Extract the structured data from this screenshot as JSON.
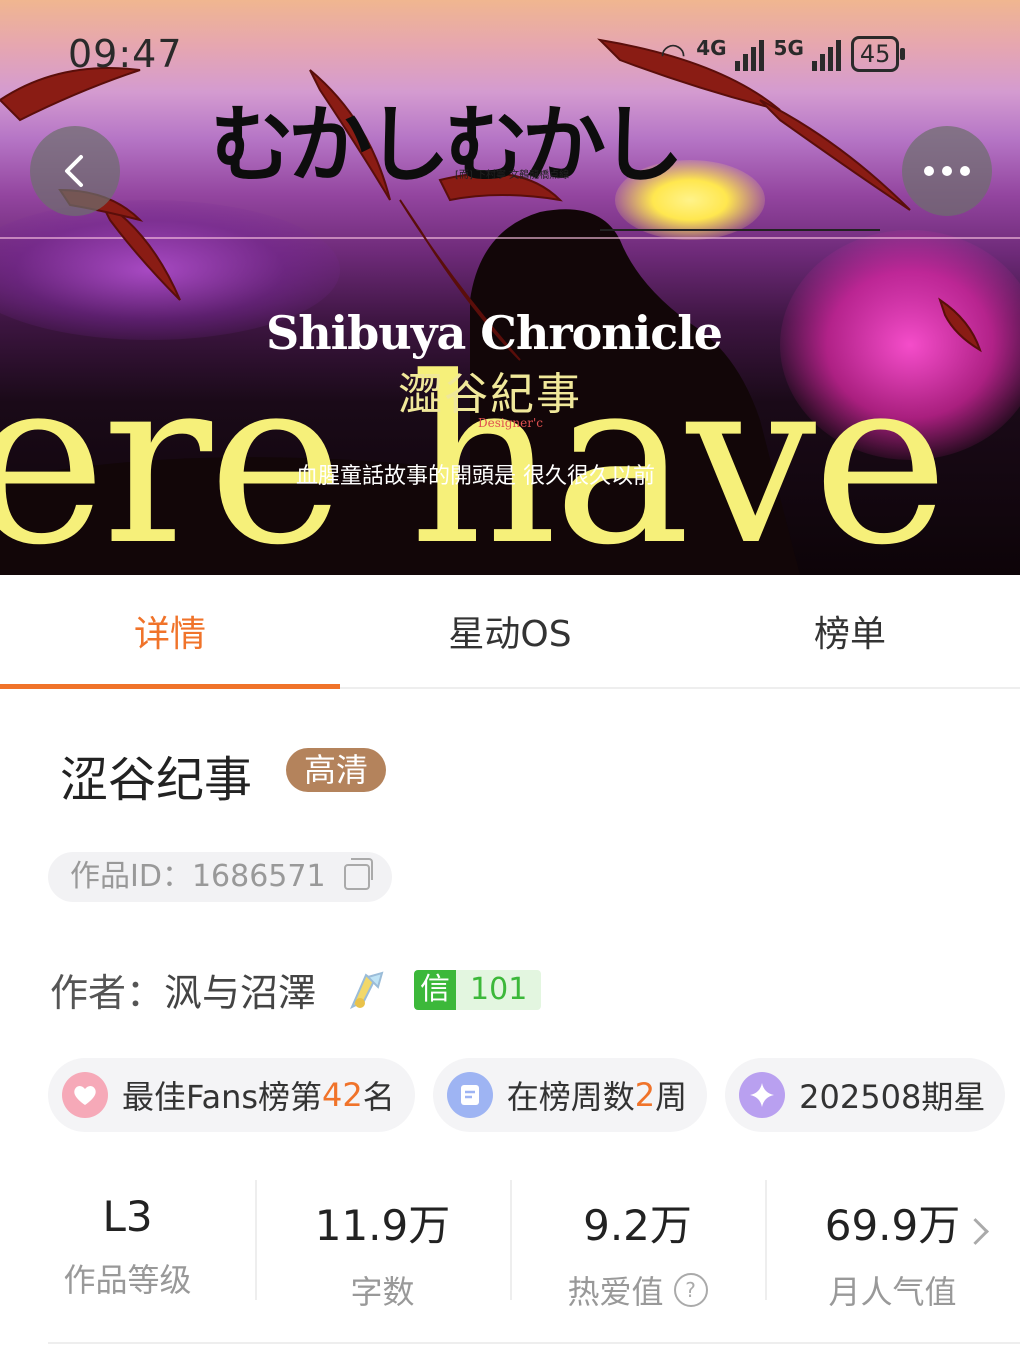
{
  "status_bar": {
    "time": "09:47",
    "net1": "4G",
    "net2": "5G",
    "battery": "45"
  },
  "banner": {
    "jp_title": "むかしむかし",
    "jp_sub": "[而] 下村寧  文鶴龍橋点線",
    "en_title": "Shibuya Chronicle",
    "cn_title": "澀谷紀事",
    "designer": "Designer'c",
    "tagline": "血腥童話故事的開頭是 很久很久以前",
    "big_text": "ere have a thou"
  },
  "nav": {
    "back_icon": "chevron-left-icon",
    "more_icon": "more-horizontal-icon"
  },
  "tabs": [
    {
      "label": "详情",
      "active": true
    },
    {
      "label": "星动OS",
      "active": false
    },
    {
      "label": "榜单",
      "active": false
    }
  ],
  "work": {
    "title": "涩谷纪事",
    "quality_badge": "高清",
    "id_text": "作品ID：1686571",
    "author_label": "作者：",
    "author_name": "沨与沼澤",
    "credit_key": "信",
    "credit_value": "101"
  },
  "chips": [
    {
      "pre": "最佳Fans榜第",
      "num": "42",
      "post": "名",
      "icon": "heart-icon"
    },
    {
      "pre": "在榜周数",
      "num": "2",
      "post": "周",
      "icon": "list-icon"
    },
    {
      "pre": "202508期星",
      "num": "",
      "post": "",
      "icon": "star-icon"
    }
  ],
  "stats": [
    {
      "value": "L3",
      "label": "作品等级"
    },
    {
      "value": "11.9万",
      "label": "字数"
    },
    {
      "value": "9.2万",
      "label": "热爱值"
    },
    {
      "value": "69.9万",
      "label": "月人气值"
    }
  ],
  "colors": {
    "accent": "#f0732a",
    "badge": "#b4835c",
    "credit": "#3cb83a"
  }
}
